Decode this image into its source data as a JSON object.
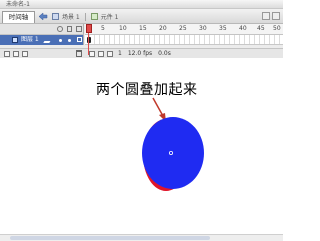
{
  "window": {
    "title": "未命名-1"
  },
  "tabbar": {
    "timeline_tab": "时间轴",
    "scene_label": "场景 1",
    "symbol_label": "元件 1"
  },
  "timeline": {
    "frame_numbers": [
      "5",
      "10",
      "15",
      "20",
      "25",
      "30",
      "35",
      "40",
      "45",
      "50"
    ],
    "layer": {
      "name": "图层 1"
    },
    "status": {
      "frame": "1",
      "fps": "12.0 fps",
      "time": "0.0s"
    }
  },
  "stage": {
    "annotation": "两个圆叠加起来"
  },
  "colors": {
    "front_ellipse": "#1f2bf2",
    "back_ellipse": "#e0152a",
    "arrow": "#c0392b",
    "layer_highlight": "#4a6fb6"
  }
}
